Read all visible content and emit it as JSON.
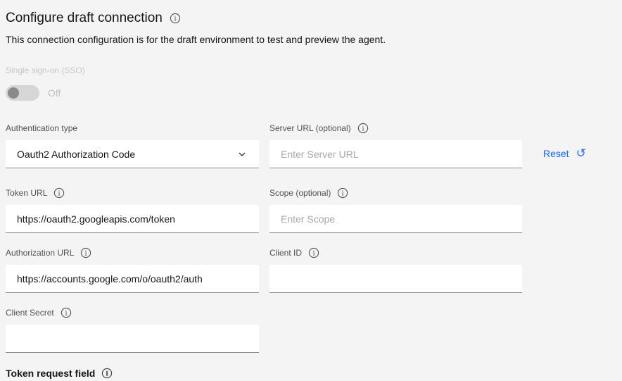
{
  "page": {
    "title": "Configure draft connection",
    "subtitle": "This connection configuration is for the draft environment to test and preview the agent."
  },
  "sso": {
    "label": "Single sign-on (SSO)",
    "state": "Off",
    "enabled": false
  },
  "form": {
    "auth_type": {
      "label": "Authentication type",
      "value": "Oauth2 Authorization Code"
    },
    "server_url": {
      "label": "Server URL (optional)",
      "placeholder": "Enter Server URL",
      "value": ""
    },
    "reset": {
      "label": "Reset"
    },
    "token_url": {
      "label": "Token URL",
      "value": "https://oauth2.googleapis.com/token"
    },
    "scope": {
      "label": "Scope (optional)",
      "placeholder": "Enter Scope",
      "value": ""
    },
    "authorization_url": {
      "label": "Authorization URL",
      "value": "https://accounts.google.com/o/oauth2/auth"
    },
    "client_id": {
      "label": "Client ID",
      "value": ""
    },
    "client_secret": {
      "label": "Client Secret",
      "value": ""
    }
  },
  "sections": {
    "token_request_field": "Token request field"
  },
  "icons": {
    "info": "info-circle",
    "chevron": "chevron-down",
    "reset": "restart-arrow"
  },
  "colors": {
    "background": "#f4f4f4",
    "field_background": "#ffffff",
    "field_border": "#8d8d8d",
    "text_primary": "#161616",
    "text_label": "#525252",
    "text_disabled": "#c6c6c6",
    "placeholder": "#a8a8a8",
    "link_blue": "#0f62fe",
    "toggle_track": "#d6d6d6",
    "toggle_knob": "#8a8a8a"
  }
}
